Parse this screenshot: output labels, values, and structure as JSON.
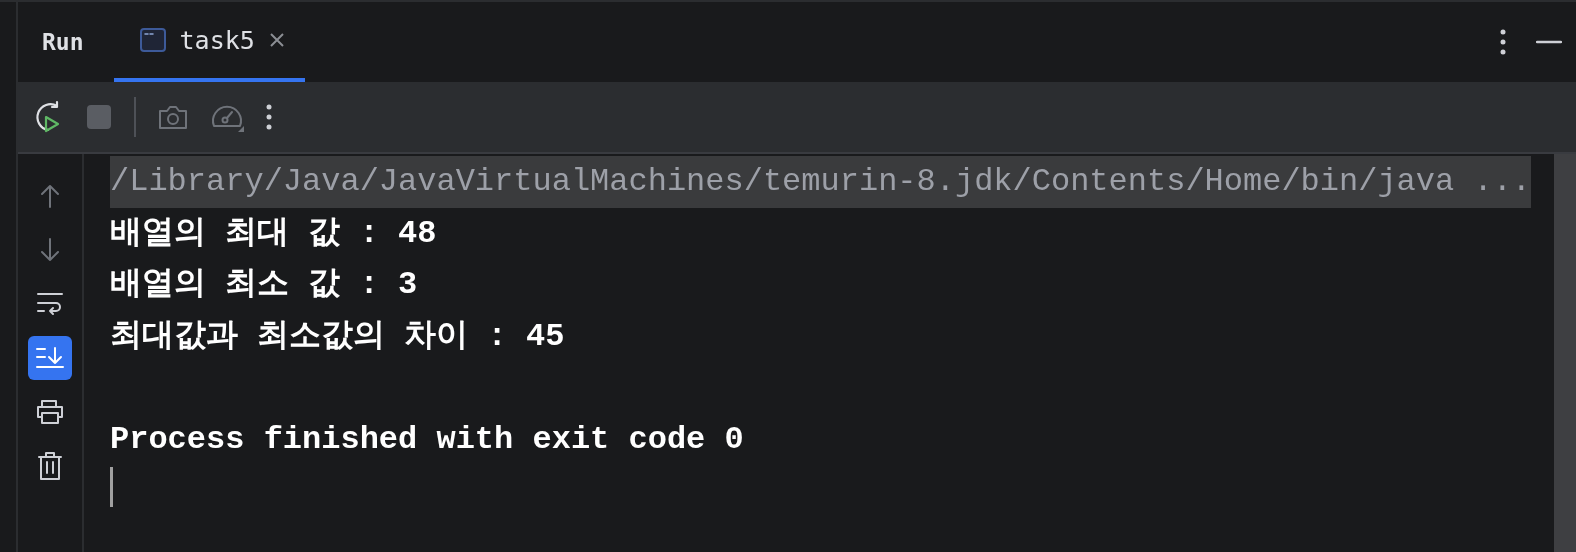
{
  "header": {
    "title": "Run"
  },
  "tabs": [
    {
      "label": "task5",
      "selected": true
    }
  ],
  "gutter": [
    {
      "kind": "up",
      "on": false
    },
    {
      "kind": "down",
      "on": false
    },
    {
      "kind": "wrap",
      "on": false
    },
    {
      "kind": "scroll-end",
      "on": true
    },
    {
      "kind": "print",
      "on": false
    },
    {
      "kind": "trash",
      "on": false
    }
  ],
  "console": [
    {
      "kind": "command",
      "text": "/Library/Java/JavaVirtualMachines/temurin-8.jdk/Contents/Home/bin/java ..."
    },
    {
      "kind": "output",
      "text": "배열의 최대 값 : 48"
    },
    {
      "kind": "output",
      "text": "배열의 최소 값 : 3"
    },
    {
      "kind": "output",
      "text": "최대값과 최소값의 차이 : 45"
    },
    {
      "kind": "blank"
    },
    {
      "kind": "output",
      "text": "Process finished with exit code 0"
    }
  ]
}
